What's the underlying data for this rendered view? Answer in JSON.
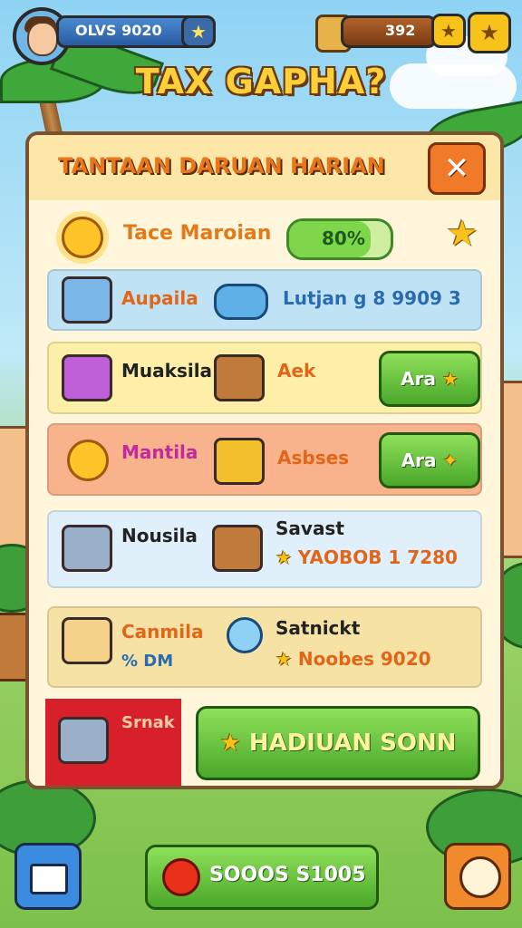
{
  "top_bar": {
    "player_value": "OLVS 9020",
    "currency_value": "392"
  },
  "title": "TAX GAPHA?",
  "panel": {
    "title": "TANTAAN DARUAN HARIAN",
    "daily": {
      "label": "Tace Maroian",
      "progress": 0.8,
      "progress_text": "80%"
    },
    "rows": [
      {
        "label": "Aupaila",
        "detail": "Lutjan g 8 9909 3"
      },
      {
        "label": "Muaksila",
        "detail": "Aek",
        "button": "Ara"
      },
      {
        "label": "Mantila",
        "detail": "Asbses",
        "button": "Ara"
      },
      {
        "label": "Nousila",
        "detail_title": "Savast",
        "detail": "YAOBOB 1 7280"
      },
      {
        "label": "Canmila",
        "sub": "% DM",
        "detail_title": "Satnickt",
        "detail": "Noobes 9020"
      }
    ],
    "footer": {
      "label": "Srnak",
      "button": "HADIUAN SONN"
    }
  },
  "bottom_bar": {
    "coins_text": "SOOOS S1005"
  },
  "colors": {
    "accent_orange": "#e8761a",
    "button_green": "#4aa82a",
    "panel_bg": "#fff6dc"
  },
  "icons": [
    "home-icon",
    "help-icon",
    "close-icon",
    "star-icon",
    "apple-icon",
    "sun-icon",
    "chest-icon"
  ]
}
